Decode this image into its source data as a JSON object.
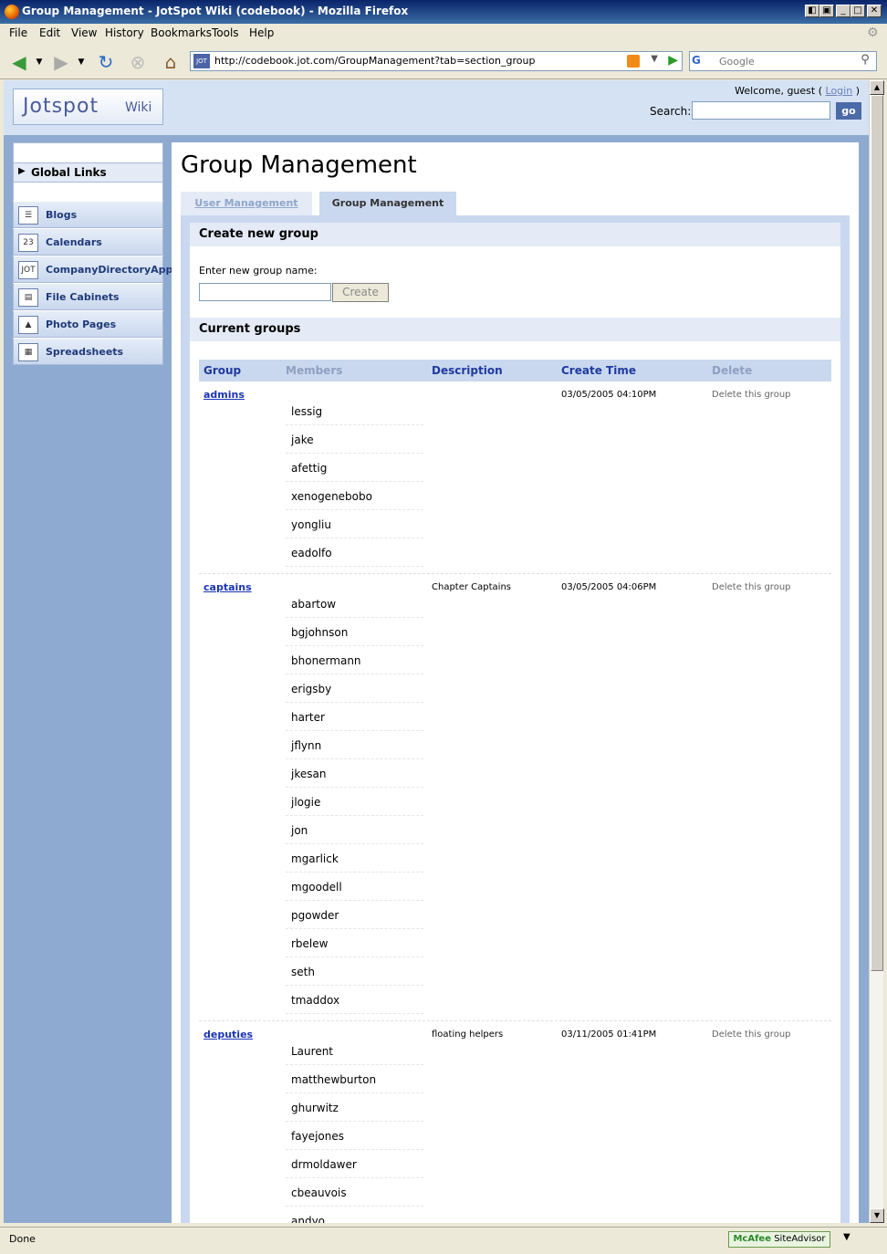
{
  "window": {
    "title": "Group Management - JotSpot Wiki (codebook) - Mozilla Firefox"
  },
  "menu": [
    "File",
    "Edit",
    "View",
    "History",
    "Bookmarks",
    "Tools",
    "Help"
  ],
  "nav": {
    "url": "http://codebook.jot.com/GroupManagement?tab=section_group",
    "favicon_text": "JOT",
    "search_placeholder": "Google",
    "search_engine_glyph": "G"
  },
  "site": {
    "logo_brand": "Jotspot",
    "logo_product": "Wiki",
    "welcome_prefix": "Welcome, guest (",
    "login_label": "Login",
    "welcome_suffix": ")",
    "search_label": "Search:",
    "go_label": "go"
  },
  "sidebar": {
    "global_links": "Global Links",
    "items": [
      {
        "label": "Blogs",
        "icon": "blog-icon",
        "glyph": "☰"
      },
      {
        "label": "Calendars",
        "icon": "calendar-icon",
        "glyph": "23"
      },
      {
        "label": "CompanyDirectoryApp",
        "icon": "jot-icon",
        "glyph": "JOT"
      },
      {
        "label": "File Cabinets",
        "icon": "file-cabinet-icon",
        "glyph": "▤"
      },
      {
        "label": "Photo Pages",
        "icon": "photo-icon",
        "glyph": "▲"
      },
      {
        "label": "Spreadsheets",
        "icon": "spreadsheet-icon",
        "glyph": "▦"
      }
    ]
  },
  "page": {
    "title": "Group Management",
    "tabs": {
      "user": "User Management",
      "group": "Group Management"
    },
    "create_section": "Create new group",
    "new_name_label": "Enter new group name:",
    "create_button": "Create",
    "current_section": "Current groups"
  },
  "table": {
    "headers": {
      "group": "Group",
      "members": "Members",
      "description": "Description",
      "create_time": "Create Time",
      "delete": "Delete"
    },
    "delete_label": "Delete this group",
    "groups": [
      {
        "name": "admins",
        "description": "",
        "time": "03/05/2005 04:10PM",
        "members": [
          "lessig",
          "jake",
          "afettig",
          "xenogenebobo",
          "yongliu",
          "eadolfo"
        ]
      },
      {
        "name": "captains",
        "description": "Chapter Captains",
        "time": "03/05/2005 04:06PM",
        "members": [
          "abartow",
          "bgjohnson",
          "bhonermann",
          "erigsby",
          "harter",
          "jflynn",
          "jkesan",
          "jlogie",
          "jon",
          "mgarlick",
          "mgoodell",
          "pgowder",
          "rbelew",
          "seth",
          "tmaddox"
        ]
      },
      {
        "name": "deputies",
        "description": "floating helpers",
        "time": "03/11/2005 01:41PM",
        "members": [
          "Laurent",
          "matthewburton",
          "ghurwitz",
          "fayejones",
          "drmoldawer",
          "cbeauvois",
          "andyo"
        ]
      }
    ]
  },
  "status": {
    "text": "Done",
    "addon": "McAfee",
    "addon_suffix": "SiteAdvisor"
  }
}
